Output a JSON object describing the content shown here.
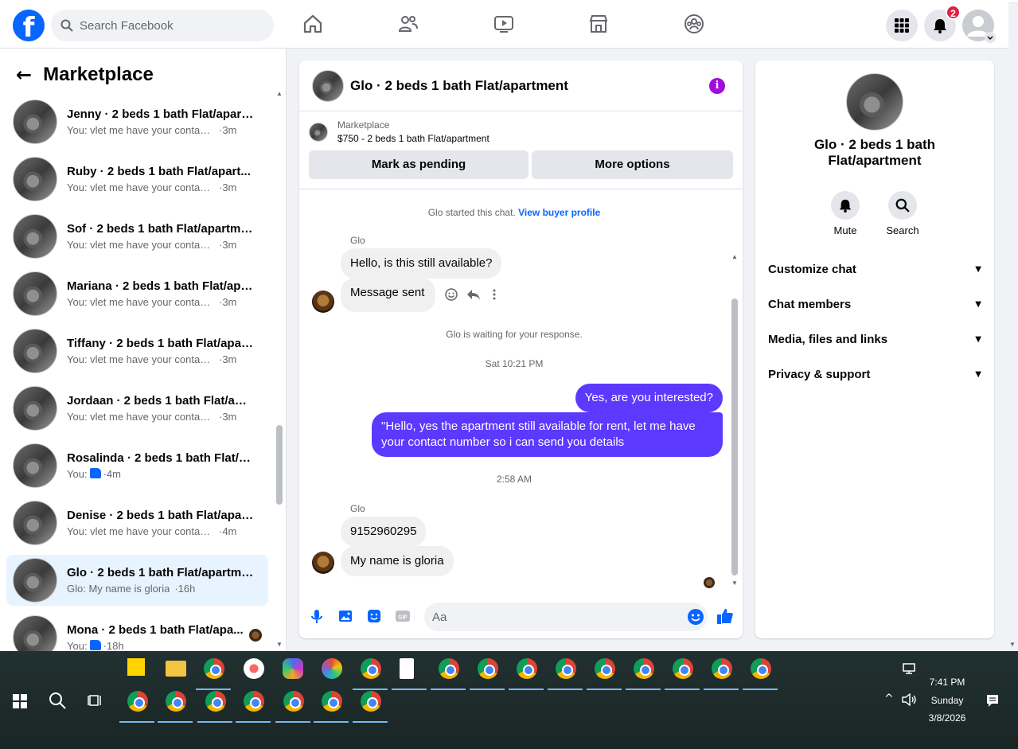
{
  "header": {
    "logo": "f",
    "search_placeholder": "Search Facebook",
    "notification_count": "2",
    "nav_icons": [
      "home-icon",
      "friends-icon",
      "video-icon",
      "marketplace-icon",
      "groups-icon"
    ]
  },
  "sidebar": {
    "back": "←",
    "title": "Marketplace",
    "conversations": [
      {
        "name": "Jenny · 2 beds 1 bath Flat/apart...",
        "snippet": "You: vlet me have your contact nu...",
        "time": "·3m",
        "like": false
      },
      {
        "name": "Ruby · 2 beds 1 bath Flat/apart...",
        "snippet": "You: vlet me have your contact nu...",
        "time": "·3m",
        "like": false
      },
      {
        "name": "Sof · 2 beds 1 bath Flat/apartment",
        "snippet": "You: vlet me have your contact nu...",
        "time": "·3m",
        "like": false
      },
      {
        "name": "Mariana · 2 beds 1 bath Flat/apa...",
        "snippet": "You: vlet me have your contact nu...",
        "time": "·3m",
        "like": false
      },
      {
        "name": "Tiffany · 2 beds 1 bath Flat/apart...",
        "snippet": "You: vlet me have your contact nu...",
        "time": "·3m",
        "like": false
      },
      {
        "name": "Jordaan · 2 beds 1 bath Flat/apa...",
        "snippet": "You: vlet me have your contact nu...",
        "time": "·3m",
        "like": false
      },
      {
        "name": "Rosalinda · 2 beds 1 bath Flat/ap...",
        "snippet": "You:",
        "time": "·4m",
        "like": true
      },
      {
        "name": "Denise · 2 beds 1 bath Flat/apart...",
        "snippet": "You: vlet me have your contact nu...",
        "time": "·4m",
        "like": false
      },
      {
        "name": "Glo · 2 beds 1 bath Flat/apartment",
        "snippet": "Glo: My name is gloria",
        "time": "·16h",
        "like": false
      },
      {
        "name": "Mona · 2 beds 1 bath Flat/apa...",
        "snippet": "You:",
        "time": "·18h",
        "like": true
      }
    ]
  },
  "chat": {
    "title": "Glo · 2 beds 1 bath Flat/apartment",
    "listing_label": "Marketplace",
    "listing_title": "$750 - 2 beds 1 bath Flat/apartment",
    "mark_pending": "Mark as pending",
    "more_options": "More options",
    "started": "Glo started this chat.",
    "view_profile": "View buyer profile",
    "sender": "Glo",
    "msg1": "Hello, is this still available?",
    "msg2": "Message sent",
    "waiting": "Glo is waiting for your response.",
    "time1": "Sat 10:21 PM",
    "out1": "Yes, are you interested?",
    "out2": "\"Hello, yes the  apartment still available for rent, let me have your contact number so i can send you details",
    "time2": "2:58 AM",
    "msg3": "9152960295",
    "msg4": "My name is gloria",
    "composer_placeholder": "Aa"
  },
  "right_panel": {
    "title": "Glo · 2 beds 1 bath Flat/apartment",
    "mute": "Mute",
    "search": "Search",
    "sections": [
      "Customize chat",
      "Chat members",
      "Media, files and links",
      "Privacy & support"
    ]
  },
  "taskbar": {
    "time": "7:41 PM",
    "day": "Sunday",
    "date": "3/8/2026"
  },
  "colors": {
    "brand": "#0866ff",
    "outgoing_bubble": "#5b39ff",
    "active_row": "#e7f3ff"
  }
}
